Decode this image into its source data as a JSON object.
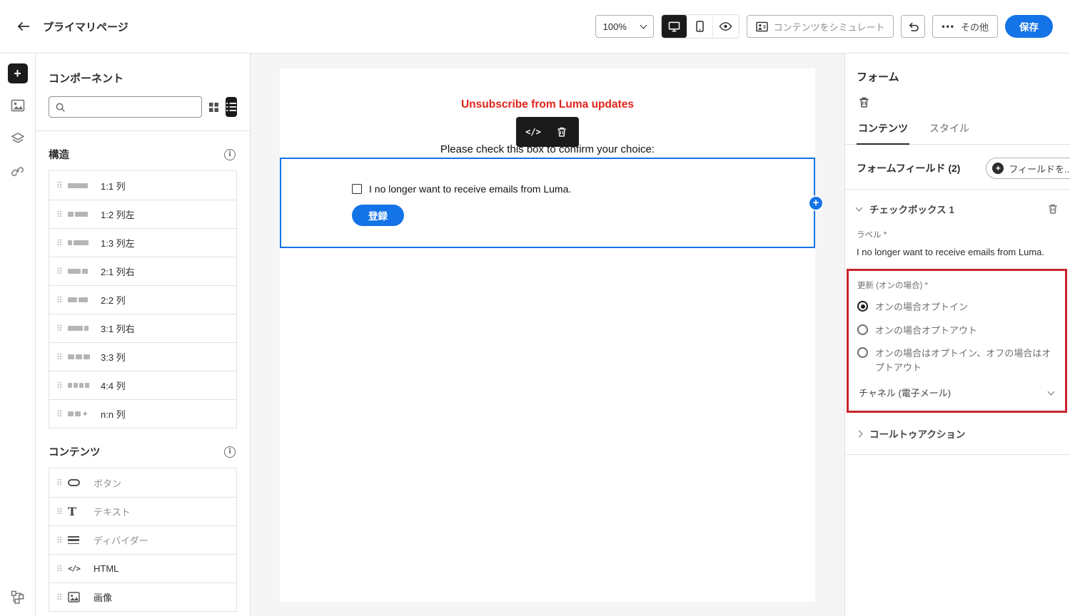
{
  "header": {
    "title": "プライマリページ",
    "zoom_value": "100%",
    "simulate_label": "コンテンツをシミュレート",
    "more_label": "その他",
    "save_label": "保存"
  },
  "sidebar": {
    "title": "コンポーネント",
    "structure_title": "構造",
    "structure_items": [
      {
        "label": "1:1 列"
      },
      {
        "label": "1:2 列左"
      },
      {
        "label": "1:3 列左"
      },
      {
        "label": "2:1 列右"
      },
      {
        "label": "2:2 列"
      },
      {
        "label": "3:1 列右"
      },
      {
        "label": "3:3 列"
      },
      {
        "label": "4:4 列"
      },
      {
        "label": "n:n 列"
      }
    ],
    "content_title": "コンテンツ",
    "content_items": [
      {
        "label": "ボタン"
      },
      {
        "label": "テキスト"
      },
      {
        "label": "ディバイダー"
      },
      {
        "label": "HTML"
      },
      {
        "label": "画像"
      }
    ]
  },
  "canvas": {
    "heading": "Unsubscribe from Luma updates",
    "instruction": "Please check this box to confirm your choice:",
    "checkbox_label": "I no longer want to receive emails from Luma.",
    "submit_label": "登録"
  },
  "panel": {
    "title": "フォーム",
    "tab_content": "コンテンツ",
    "tab_style": "スタイル",
    "fields_title": "フォームフィールド (2)",
    "add_field_label": "フィールドを...",
    "checkbox_section_title": "チェックボックス 1",
    "label_caption": "ラベル *",
    "label_value": "I no longer want to receive emails from Luma.",
    "update_caption": "更新 (オンの場合) *",
    "radio_options": [
      "オンの場合オプトイン",
      "オンの場合オプトアウト",
      "オンの場合はオプトイン、オフの場合はオプトアウト"
    ],
    "channel_label": "チャネル (電子メール)",
    "cta_label": "コールトゥアクション"
  },
  "colors": {
    "accent_blue": "#1473e6",
    "heading_red": "#e2231a",
    "annotation_red": "#c9252d",
    "toolbar_dark": "#1b1b1b"
  }
}
